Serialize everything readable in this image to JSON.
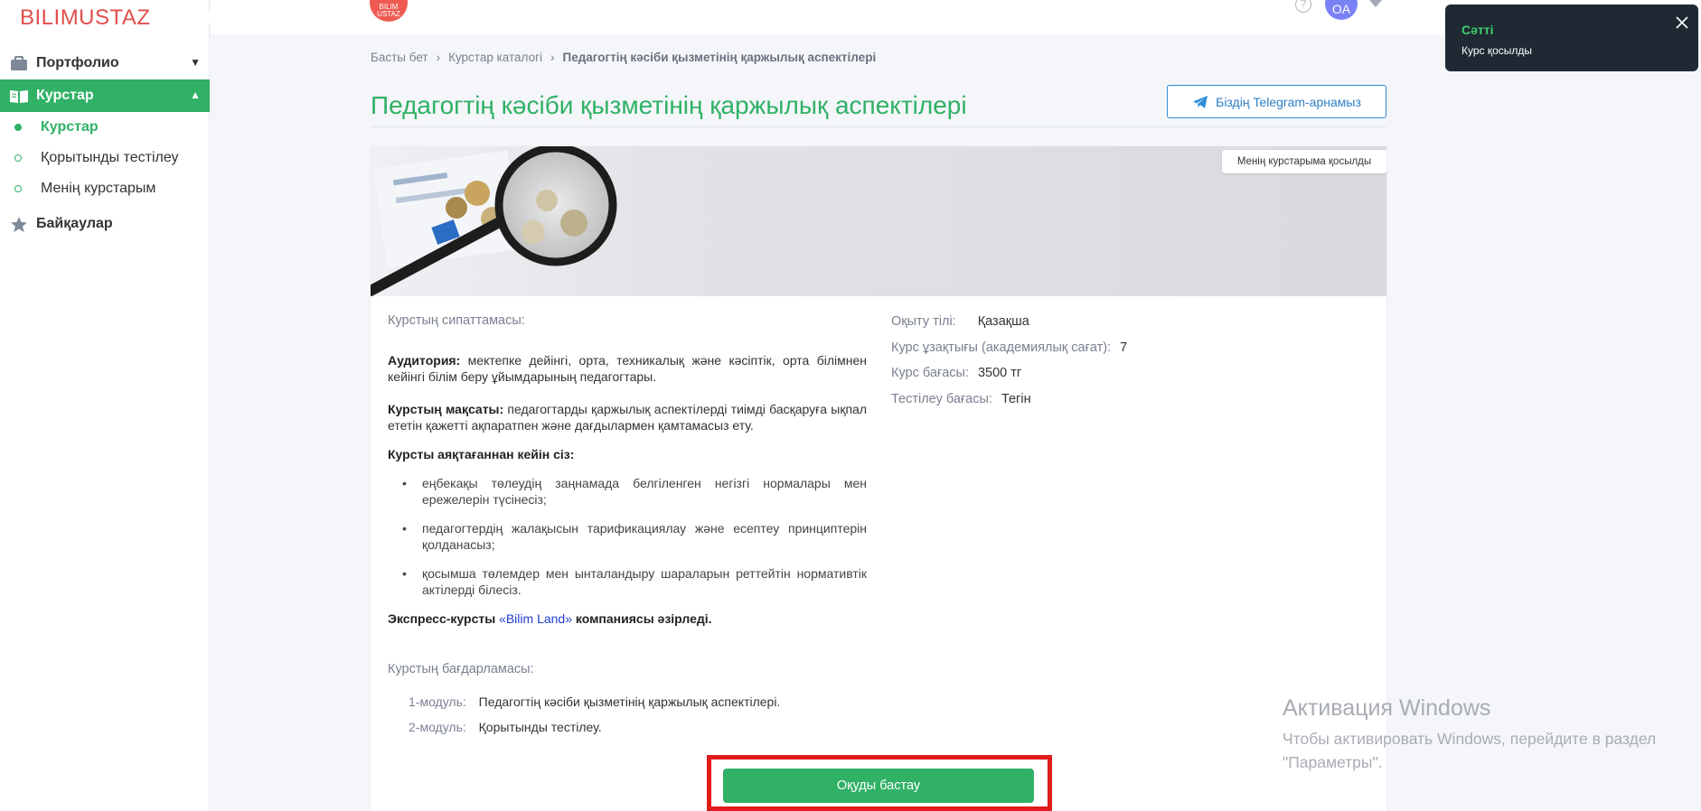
{
  "brand": {
    "logo": "BILIMUSTAZ",
    "header_logo": "BILIM USTAZ"
  },
  "user": {
    "initials": "OA"
  },
  "sidebar": {
    "items": [
      {
        "label": "Портфолио"
      },
      {
        "label": "Курстар"
      },
      {
        "label": "Байқаулар"
      }
    ],
    "subitems": [
      {
        "label": "Курстар"
      },
      {
        "label": "Қорытынды тестілеу"
      },
      {
        "label": "Менің курстарым"
      }
    ]
  },
  "breadcrumb": [
    "Басты бет",
    "Курстар каталогі",
    "Педагогтің кәсіби қызметінің қаржылық аспектілері"
  ],
  "page": {
    "title": "Педагогтің кәсіби қызметінің қаржылық аспектілері",
    "telegram_button": "Біздің Telegram-арнамыз",
    "added_tag": "Менің курстарыма қосылды"
  },
  "description": {
    "label": "Курстың сипаттамасы:",
    "audience_label": "Аудитория:",
    "audience_text": " мектепке дейінгі, орта, техникалық және кәсіптік, орта білімнен кейінгі білім беру ұйымдарының педагогтары.",
    "goal_label": "Курстың мақсаты:",
    "goal_text": " педагогтарды қаржылық аспектілерді тиімді басқаруға ықпал ететін қажетті ақпаратпен және дағдылармен қамтамасыз ету.",
    "after_title": "Курсты аяқтағаннан кейін сіз:",
    "bullets": [
      "еңбекақы төлеудің заңнамада белгіленген негізгі нормалары мен ережелерін түсінесіз;",
      "педагогтердің жалақысын тарификациялау және есептеу принциптерін қолданасыз;",
      "қосымша төлемдер мен ынталандыру шараларын реттейтін нормативтік актілерді білесіз."
    ],
    "express_prefix": "Экспресс-курсты ",
    "express_link": "«Bilim Land»",
    "express_suffix": " компаниясы әзірледі."
  },
  "info": [
    {
      "key": "Оқыту тілі:",
      "value": "Қазақша"
    },
    {
      "key": "Курс ұзақтығы (академиялық сағат):",
      "value": "7"
    },
    {
      "key": "Курс бағасы:",
      "value": "3500 тг"
    },
    {
      "key": "Тестілеу бағасы:",
      "value": "Тегін"
    }
  ],
  "program": {
    "label": "Курстың бағдарламасы:",
    "modules": [
      {
        "label": "1-модуль:",
        "text": "Педагогтің кәсіби қызметінің қаржылық аспектілері."
      },
      {
        "label": "2-модуль:",
        "text": "Қорытынды тестілеу."
      }
    ]
  },
  "start_button": "Оқуды бастау",
  "toast": {
    "title": "Сәтті",
    "message": "Курс қосылды"
  },
  "windows_activation": {
    "title": "Активация Windows",
    "line1": "Чтобы активировать Windows, перейдите в раздел",
    "line2": "\"Параметры\"."
  },
  "colors": {
    "accent": "#30b166",
    "toast_bg": "#1f2933",
    "highlight": "#e11b1b",
    "link": "#1f3ccf"
  }
}
